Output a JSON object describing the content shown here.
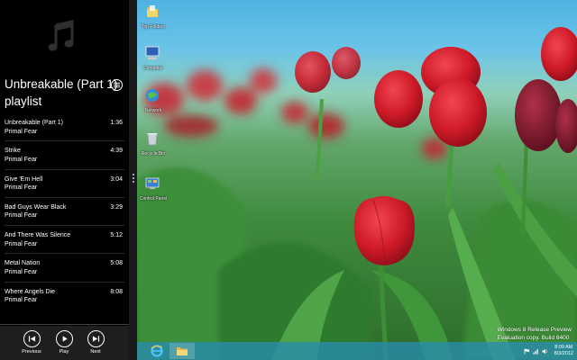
{
  "music": {
    "playlist_title_line1": "Unbreakable (Part 1)",
    "playlist_title_line2": "playlist",
    "tracks": [
      {
        "title": "Unbreakable (Part 1)",
        "artist": "Primal Fear",
        "duration": "1:36"
      },
      {
        "title": "Strike",
        "artist": "Primal Fear",
        "duration": "4:39"
      },
      {
        "title": "Give 'Em Hell",
        "artist": "Primal Fear",
        "duration": "3:04"
      },
      {
        "title": "Bad Guys Wear Black",
        "artist": "Primal Fear",
        "duration": "3:29"
      },
      {
        "title": "And There Was Silence",
        "artist": "Primal Fear",
        "duration": "5:12"
      },
      {
        "title": "Metal Nation",
        "artist": "Primal Fear",
        "duration": "5:08"
      },
      {
        "title": "Where Angels Die",
        "artist": "Primal Fear",
        "duration": "8:08"
      }
    ],
    "controls": {
      "previous": "Previous",
      "play": "Play",
      "next": "Next"
    }
  },
  "desktop": {
    "icons": [
      {
        "label": "Top Folders",
        "icon": "folder-icon"
      },
      {
        "label": "Computer",
        "icon": "computer-icon"
      },
      {
        "label": "Network",
        "icon": "network-icon"
      },
      {
        "label": "Recycle Bin",
        "icon": "recycle-bin-icon"
      },
      {
        "label": "Control Panel",
        "icon": "control-panel-icon"
      }
    ],
    "watermark": {
      "line1": "Windows 8 Release Preview",
      "line2": "Evaluation copy. Build 8400"
    }
  },
  "taskbar": {
    "pinned": [
      {
        "name": "Internet Explorer",
        "icon": "internet-explorer-icon"
      },
      {
        "name": "File Explorer",
        "icon": "file-explorer-icon"
      }
    ],
    "time": "8:09 AM",
    "date": "8/3/2012"
  },
  "colors": {
    "music_bg": "#000000",
    "controls_bg": "#1e1e1e",
    "taskbar": "#288caf",
    "tulip_red": "#d8202c",
    "sky": "#4fb3e3"
  }
}
